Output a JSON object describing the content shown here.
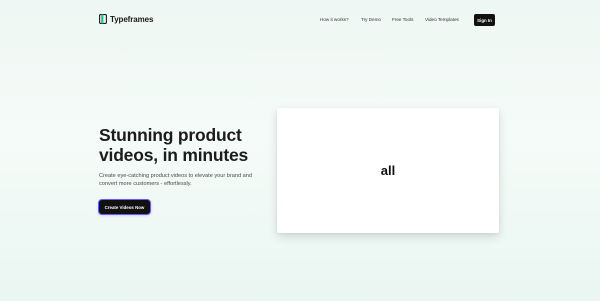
{
  "brand": {
    "name": "Typeframes",
    "icon": "typeframes-logo-icon",
    "accent": "#23c48f"
  },
  "nav": {
    "links": [
      {
        "label": "How it works?"
      },
      {
        "label": "Try Demo"
      },
      {
        "label": "Free Tools"
      },
      {
        "label": "Video Templates"
      }
    ],
    "signin_label": "Sign In"
  },
  "hero": {
    "title": "Stunning product videos, in minutes",
    "subtitle": "Create eye-catching product videos to elevate your brand and convert more customers - effortlessly.",
    "cta_label": "Create Videos Now",
    "cta_glow": "#6b5cff"
  },
  "video_preview": {
    "word": "all"
  }
}
